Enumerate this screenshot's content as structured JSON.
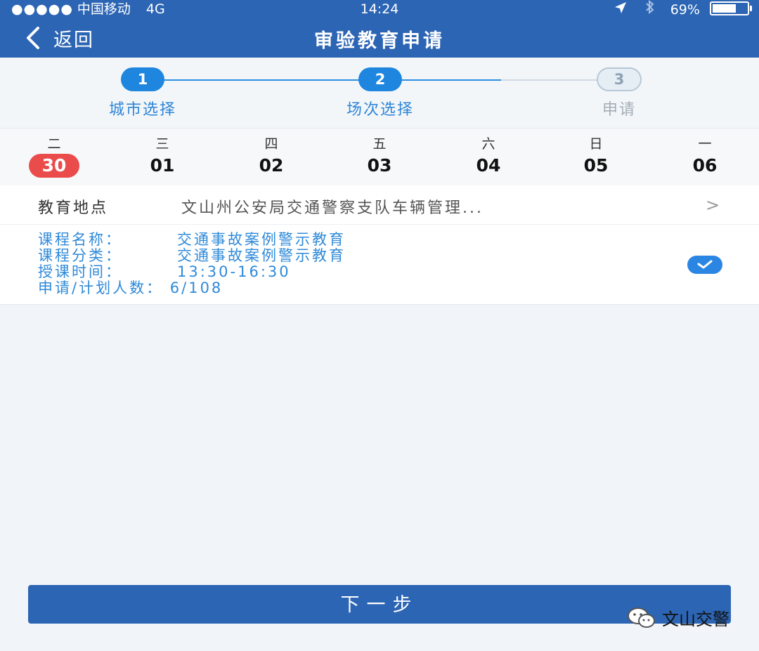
{
  "status_bar": {
    "signal_dots": "●●●●●",
    "carrier": "中国移动",
    "network": "4G",
    "time": "14:24",
    "battery_percent": "69%",
    "battery_level": 0.69
  },
  "nav": {
    "back_label": "返回",
    "title": "审验教育申请"
  },
  "steps": [
    {
      "number": "1",
      "label": "城市选择",
      "state": "done"
    },
    {
      "number": "2",
      "label": "场次选择",
      "state": "active"
    },
    {
      "number": "3",
      "label": "申请",
      "state": "pending"
    }
  ],
  "dates": [
    {
      "weekday": "二",
      "day": "30",
      "selected": true
    },
    {
      "weekday": "三",
      "day": "01",
      "selected": false
    },
    {
      "weekday": "四",
      "day": "02",
      "selected": false
    },
    {
      "weekday": "五",
      "day": "03",
      "selected": false
    },
    {
      "weekday": "六",
      "day": "04",
      "selected": false
    },
    {
      "weekday": "日",
      "day": "05",
      "selected": false
    },
    {
      "weekday": "一",
      "day": "06",
      "selected": false
    }
  ],
  "location": {
    "label": "教育地点",
    "value": "文山州公安局交通警察支队车辆管理...",
    "chevron": ">"
  },
  "course": {
    "name_key": "课程名称：",
    "name_value": "交通事故案例警示教育",
    "category_key": "课程分类：",
    "category_value": "交通事故案例警示教育",
    "time_key": "授课时间：",
    "time_value": "13:30-16:30",
    "count_key": "申请/计划人数：",
    "count_value": "6/108"
  },
  "next_button": "下一步",
  "watermark": "文山交警",
  "colors": {
    "brand_blue": "#2c65b4",
    "step_blue": "#1e86df",
    "selected_date_red": "#ea4b4b",
    "course_text_blue": "#2f8ad9"
  },
  "icons": {
    "back": "chevron-left-icon",
    "location_arrow": "location-arrow-icon",
    "bluetooth": "bluetooth-icon",
    "battery": "battery-icon",
    "check": "check-icon",
    "wechat": "wechat-icon"
  }
}
